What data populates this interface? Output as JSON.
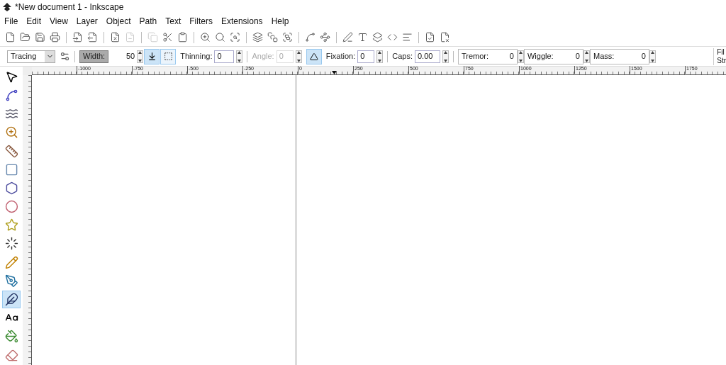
{
  "window": {
    "title": "*New document 1 - Inkscape"
  },
  "menu": [
    "File",
    "Edit",
    "View",
    "Layer",
    "Object",
    "Path",
    "Text",
    "Filters",
    "Extensions",
    "Help"
  ],
  "command_bar": [
    [
      {
        "disabled": false
      },
      {
        "disabled": false
      },
      {
        "disabled": false
      },
      {
        "disabled": false
      }
    ],
    [
      {
        "disabled": false
      },
      {
        "disabled": false
      }
    ],
    [
      {
        "disabled": false
      },
      {
        "disabled": true
      }
    ],
    [
      {
        "disabled": true
      },
      {
        "disabled": false
      },
      {
        "disabled": false
      }
    ],
    [
      {
        "disabled": false
      },
      {
        "disabled": false
      },
      {
        "disabled": false
      }
    ],
    [
      {
        "disabled": false
      },
      {
        "disabled": false
      },
      {
        "disabled": false
      }
    ],
    [
      {
        "disabled": false
      },
      {
        "disabled": false
      }
    ],
    [
      {
        "disabled": false
      },
      {
        "disabled": false
      },
      {
        "disabled": false
      },
      {
        "disabled": false
      },
      {
        "disabled": false
      }
    ],
    [
      {
        "disabled": false
      },
      {
        "disabled": false
      }
    ]
  ],
  "tool_controls": {
    "preset": "Tracing",
    "width": {
      "label": "Width:",
      "value": "50"
    },
    "width_modes": [
      {
        "selected": true
      },
      {
        "selected": false
      }
    ],
    "thinning": {
      "label": "Thinning:",
      "value": "0"
    },
    "angle": {
      "label": "Angle:",
      "value": "0",
      "disabled": true
    },
    "angle_mode": {
      "selected": true
    },
    "fixation": {
      "label": "Fixation:",
      "value": "0"
    },
    "caps": {
      "label": "Caps:",
      "value": "0.00"
    },
    "tremor": {
      "label": "Tremor:",
      "value": "0"
    },
    "wiggle": {
      "label": "Wiggle:",
      "value": "0"
    },
    "mass": {
      "label": "Mass:",
      "value": "0"
    },
    "style": [
      "Fil",
      "Str"
    ]
  },
  "ruler": {
    "labels": [
      "-1000",
      "-750",
      "-500",
      "-250",
      "0",
      "250",
      "500",
      "750",
      "1000",
      "1250",
      "1500",
      "1750"
    ]
  },
  "tools": [
    {
      "selected": false
    },
    {
      "selected": false
    },
    {
      "selected": false
    },
    {
      "selected": false
    },
    {
      "selected": false
    },
    {
      "selected": false
    },
    {
      "selected": false
    },
    {
      "selected": false
    },
    {
      "selected": false
    },
    {
      "selected": false
    },
    {
      "selected": false
    },
    {
      "selected": false
    },
    {
      "selected": true
    },
    {
      "selected": false
    },
    {
      "selected": false
    },
    {
      "selected": false
    }
  ]
}
